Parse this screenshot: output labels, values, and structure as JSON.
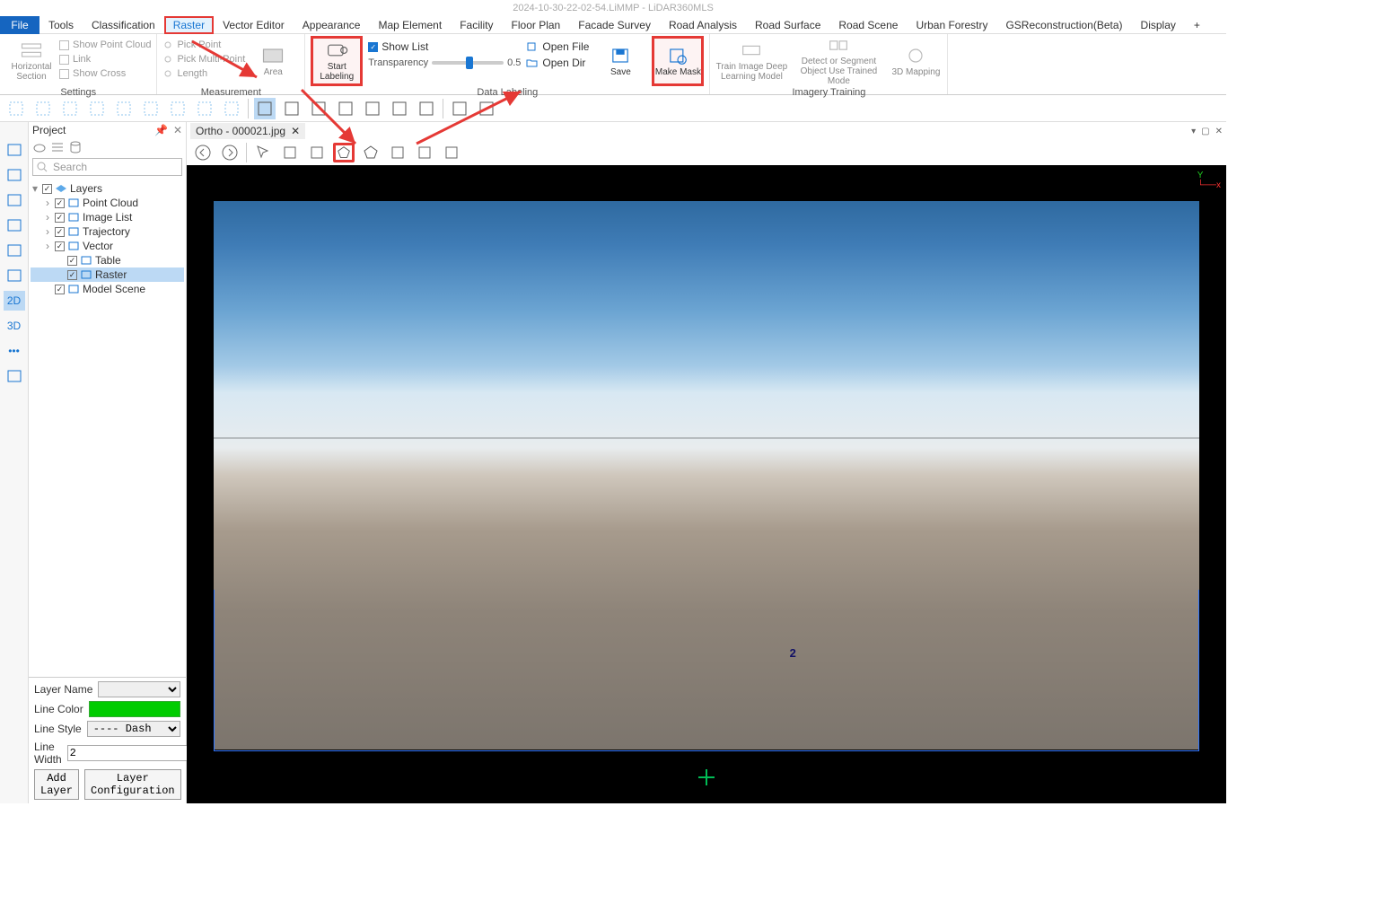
{
  "title": "2024-10-30-22-02-54.LiMMP - LiDAR360MLS",
  "menu": {
    "file": "File",
    "items": [
      "Tools",
      "Classification",
      "Raster",
      "Vector Editor",
      "Appearance",
      "Map Element",
      "Facility",
      "Floor Plan",
      "Facade Survey",
      "Road Analysis",
      "Road Surface",
      "Road Scene",
      "Urban Forestry",
      "GSReconstruction(Beta)",
      "Display",
      "+"
    ],
    "highlight_index": 2
  },
  "ribbon": {
    "settings": {
      "title": "Settings",
      "horizontal_section": "Horizontal\nSection",
      "items": [
        "Show Point Cloud",
        "Link",
        "Show Cross"
      ]
    },
    "measurement": {
      "title": "Measurement",
      "items": [
        "Pick Point",
        "Pick Multi-Point",
        "Length"
      ],
      "area": "Area"
    },
    "data_labeling": {
      "title": "Data Labeling",
      "start_labeling": "Start\nLabeling",
      "show_list": "Show List",
      "transparency": "Transparency",
      "transparency_value": "0.5",
      "open_file": "Open File",
      "open_dir": "Open Dir",
      "save": "Save",
      "make_mask": "Make\nMask"
    },
    "imagery_training": {
      "title": "Imagery Training",
      "train": "Train Image Deep\nLearning Model",
      "detect": "Detect or Segment Object\nUse Trained Mode",
      "mapping": "3D\nMapping"
    }
  },
  "project": {
    "title": "Project",
    "search_placeholder": "Search",
    "layers_root": "Layers",
    "nodes": [
      "Point Cloud",
      "Image List",
      "Trajectory",
      "Vector",
      "Table",
      "Raster",
      "Model Scene"
    ],
    "props": {
      "layer_name": "Layer Name",
      "line_color": "Line Color",
      "line_style_label": "Line Style",
      "line_style": "---- Dash",
      "line_width_label": "Line Width",
      "line_width": "2",
      "add_layer": "Add Layer",
      "layer_config": "Layer Configuration"
    }
  },
  "left_rail": {
    "labels": [
      "H",
      "ED",
      "Xray",
      "cube",
      "arrows",
      "box",
      "2D",
      "3D",
      "dots",
      "img"
    ]
  },
  "viewer": {
    "tab": "Ortho - 000021.jpg",
    "mask_index": "2",
    "axes": {
      "x": "x",
      "y": "Y"
    },
    "tab_controls": [
      "▾",
      "▢",
      "✕"
    ]
  }
}
